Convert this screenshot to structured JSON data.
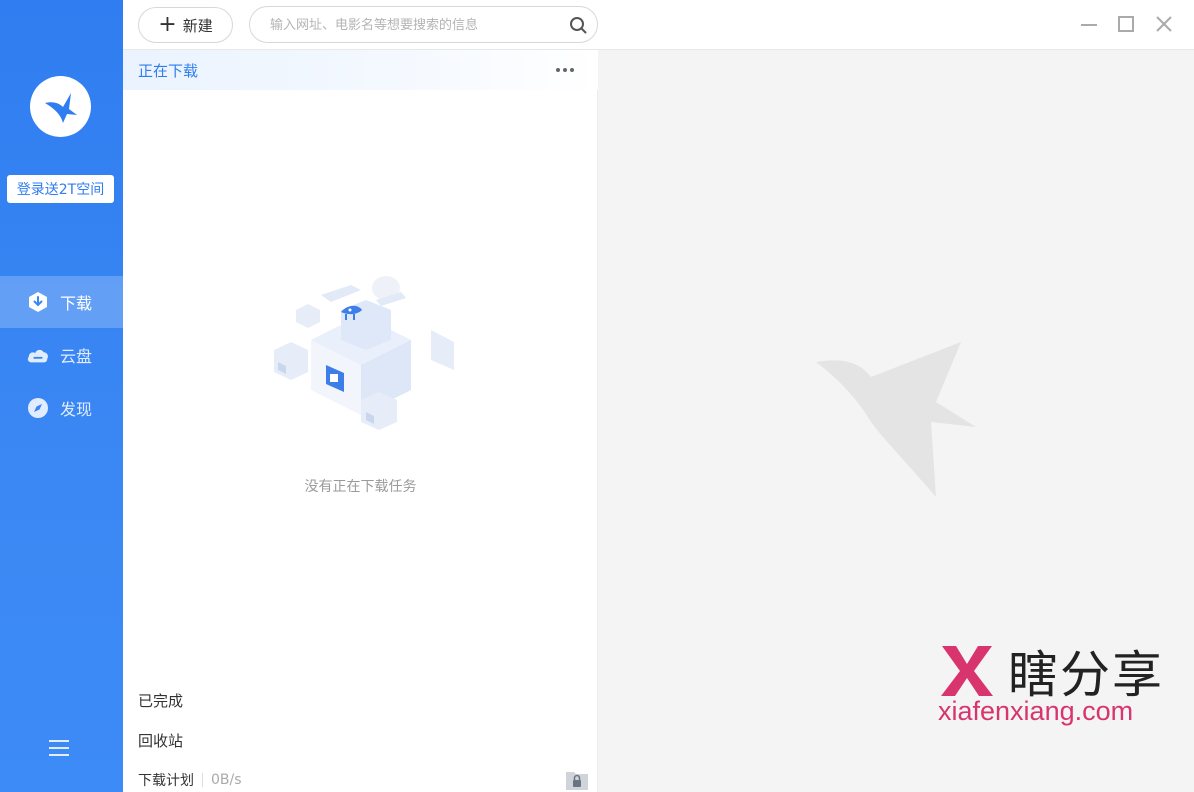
{
  "sidebar": {
    "login_label": "登录送2T空间",
    "nav": [
      {
        "label": "下载",
        "icon": "download-icon",
        "active": true
      },
      {
        "label": "云盘",
        "icon": "cloud-icon",
        "active": false
      },
      {
        "label": "发现",
        "icon": "compass-icon",
        "active": false
      }
    ],
    "menu_icon": "hamburger-menu-icon"
  },
  "toolbar": {
    "new_label": "新建",
    "search_placeholder": "输入网址、电影名等想要搜索的信息"
  },
  "downloads": {
    "title": "正在下载",
    "empty_text": "没有正在下载任务",
    "completed_label": "已完成",
    "recycle_label": "回收站",
    "plan_label": "下载计划",
    "speed": "0B/s"
  },
  "watermark": {
    "brand_cn": "瞎分享",
    "url": "xiafenxiang.com"
  },
  "colors": {
    "accent": "#2f7df0",
    "watermark_pink": "#d8346d",
    "right_bg": "#f4f4f4"
  }
}
